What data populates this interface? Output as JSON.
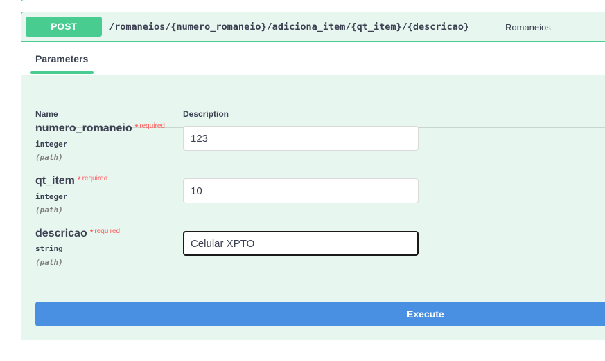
{
  "operation": {
    "method": "POST",
    "path": "/romaneios/{numero_romaneio}/adiciona_item/{qt_item}/{descricao}",
    "tag": "Romaneios"
  },
  "tabs": {
    "parameters": "Parameters"
  },
  "table": {
    "col_name": "Name",
    "col_description": "Description"
  },
  "params": [
    {
      "name": "numero_romaneio",
      "required_star": "*",
      "required_label": "required",
      "type": "integer",
      "in": "(path)",
      "value": "123"
    },
    {
      "name": "qt_item",
      "required_star": "*",
      "required_label": "required",
      "type": "integer",
      "in": "(path)",
      "value": "10"
    },
    {
      "name": "descricao",
      "required_star": "*",
      "required_label": "required",
      "type": "string",
      "in": "(path)",
      "value": "Celular XPTO"
    }
  ],
  "execute_label": "Execute",
  "colors": {
    "post_green": "#49cc90",
    "block_bg": "#e8f6f0",
    "execute_blue": "#4990e2",
    "required_red": "#ff6060"
  }
}
